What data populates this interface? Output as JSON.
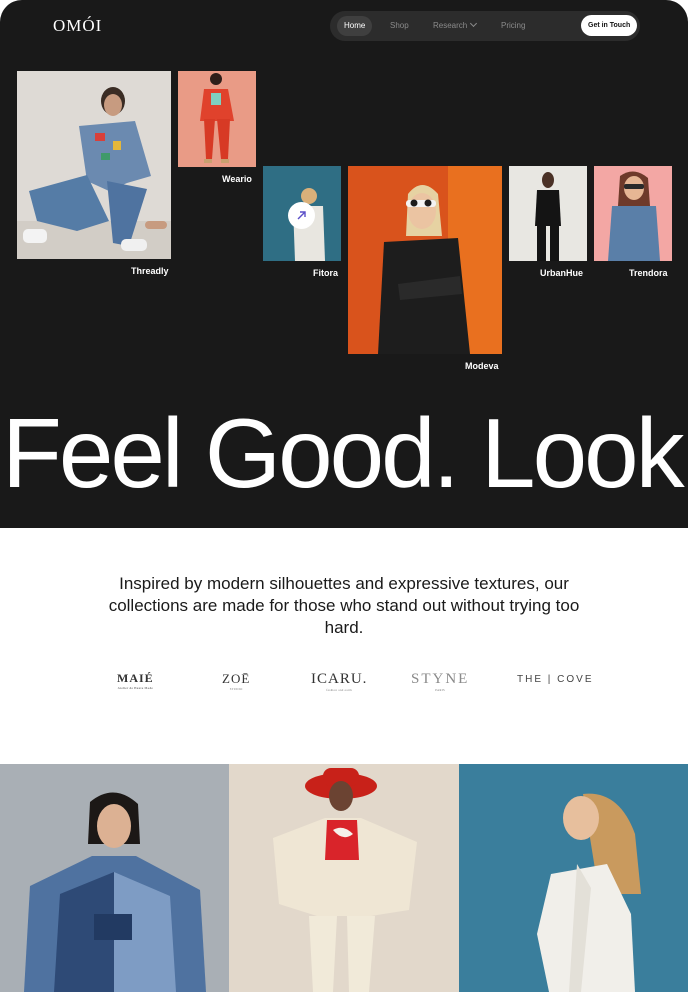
{
  "logo": "OMÓI",
  "nav": {
    "items": [
      "Home",
      "Shop",
      "Research",
      "Pricing"
    ],
    "cta": "Get in Touch"
  },
  "gallery": {
    "labels": [
      "Threadly",
      "Weario",
      "Fitora",
      "Modeva",
      "UrbanHue",
      "Trendora"
    ]
  },
  "headline": "Feel Good. Look",
  "intro": "Inspired by modern silhouettes and expressive textures, our collections are made for those who stand out without trying too hard.",
  "brands": [
    {
      "name": "MAIÉ",
      "tagline": "Atelier de Haute Mode"
    },
    {
      "name": "ZOĒ",
      "tagline": "STUDIO"
    },
    {
      "name": "ICARU.",
      "tagline": "fashion and earth"
    },
    {
      "name": "STYNE",
      "tagline": "PARIS"
    },
    {
      "name": "THE | COVE",
      "tagline": ""
    }
  ],
  "colors": {
    "hero_bg": "#191919",
    "nav_bg": "#2c2c2c",
    "page_bg": "#ffffff"
  }
}
